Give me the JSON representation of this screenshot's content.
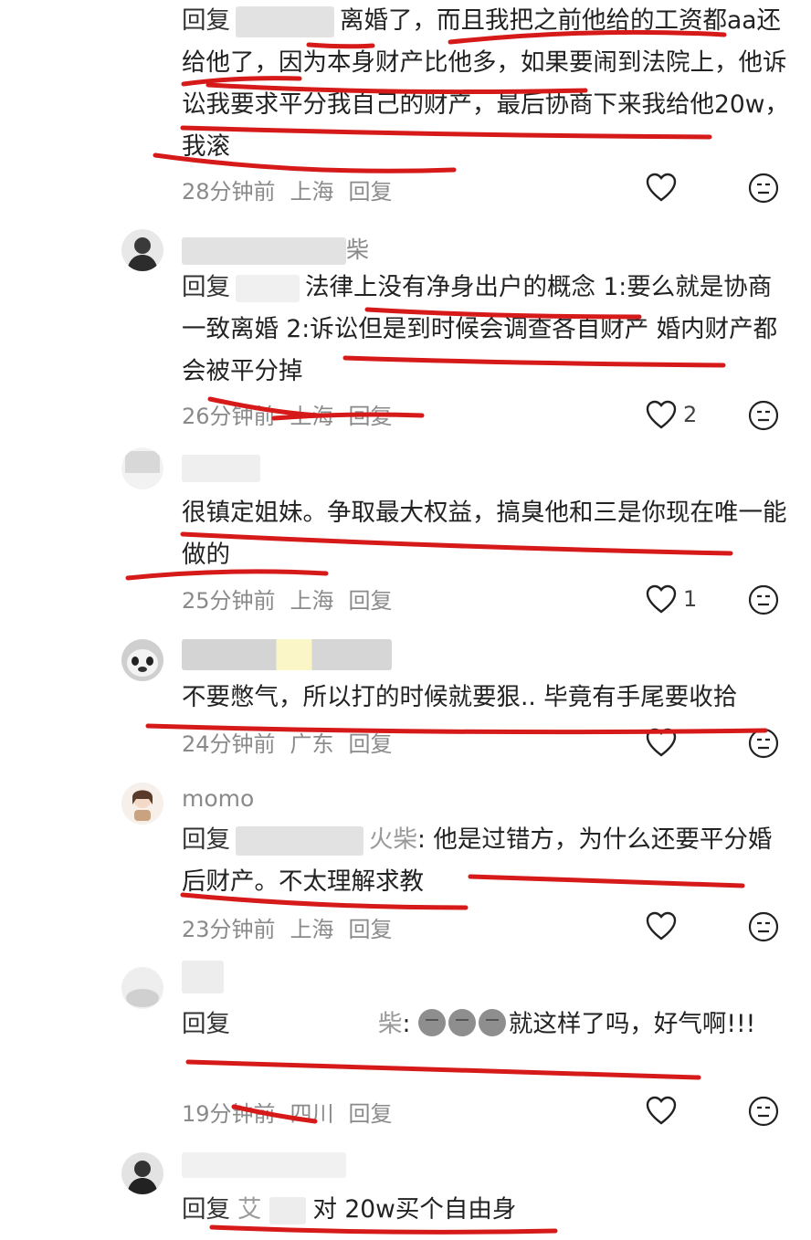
{
  "comments": [
    {
      "reply_prefix": "回复",
      "text": "离婚了，而且我把之前他给的工资都aa还给他了，因为本身财产比他多，如果要闹到法院上，他诉讼我要求平分我自己的财产，最后协商下来我给他20w，我滚",
      "time": "28分钟前",
      "location": "上海",
      "reply_label": "回复",
      "likes": ""
    },
    {
      "username": "柴",
      "reply_prefix": "回复",
      "text": "法律上没有净身出户的概念 1:要么就是协商一致离婚 2:诉讼但是到时候会调查各自财产 婚内财产都会被平分掉",
      "time": "26分钟前",
      "location": "上海",
      "reply_label": "回复",
      "likes": "2"
    },
    {
      "username": "",
      "text": "很镇定姐妹。争取最大权益，搞臭他和三是你现在唯一能做的",
      "time": "25分钟前",
      "location": "上海",
      "reply_label": "回复",
      "likes": "1"
    },
    {
      "username": "",
      "text": "不要憋气，所以打的时候就要狠.. 毕竟有手尾要收拾",
      "time": "24分钟前",
      "location": "广东",
      "reply_label": "回复",
      "likes": ""
    },
    {
      "username": "momo",
      "reply_prefix": "回复",
      "reply_target": "火柴",
      "text": "他是过错方，为什么还要平分婚后财产。不太理解求教",
      "time": "23分钟前",
      "location": "上海",
      "reply_label": "回复",
      "likes": ""
    },
    {
      "username": "",
      "reply_prefix": "回复",
      "reply_target": "柴",
      "text": "就这样了吗，好气啊!!!",
      "time": "19分钟前",
      "location": "四川",
      "reply_label": "回复",
      "likes": ""
    },
    {
      "username": "",
      "reply_prefix": "回复",
      "reply_target": "艾",
      "text": "对 20w买个自由身"
    }
  ],
  "colors": {
    "underline": "#d61a1a",
    "meta": "#8a8a8a",
    "text": "#222222"
  },
  "icons": {
    "like": "heart-icon",
    "react": "smiley-face-icon"
  }
}
